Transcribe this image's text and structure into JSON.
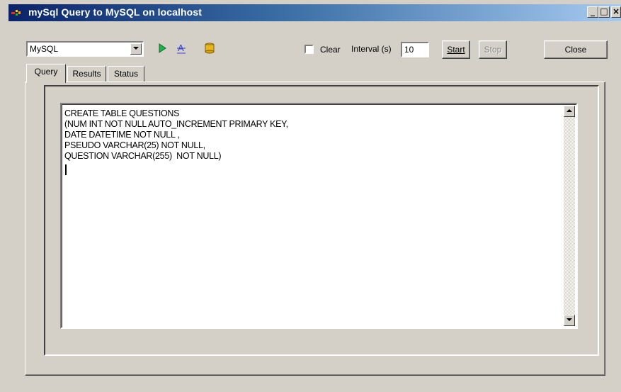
{
  "window": {
    "title": "mySql Query to MySQL on localhost",
    "minimize_glyph": "_",
    "maximize_glyph": "□",
    "close_glyph": "×"
  },
  "toolbar": {
    "database_value": "MySQL",
    "icons": [
      "run-icon",
      "format-icon",
      "database-icon"
    ],
    "clear_label": "Clear",
    "clear_checked": false,
    "interval_label": "Interval (s)",
    "interval_value": "10",
    "start_label": "Start",
    "stop_label": "Stop",
    "close_label": "Close"
  },
  "tabs": [
    {
      "label": "Query",
      "active": true
    },
    {
      "label": "Results",
      "active": false
    },
    {
      "label": "Status",
      "active": false
    }
  ],
  "editor": {
    "lines": "CREATE TABLE QUESTIONS\n(NUM INT NOT NULL AUTO_INCREMENT PRIMARY KEY,\nDATE DATETIME NOT NULL ,\nPSEUDO VARCHAR(25) NOT NULL,\nQUESTION VARCHAR(255)  NOT NULL)"
  },
  "colors": {
    "titlebar_start": "#0a246a",
    "titlebar_end": "#a6caf0",
    "face": "#d4d0c8"
  }
}
